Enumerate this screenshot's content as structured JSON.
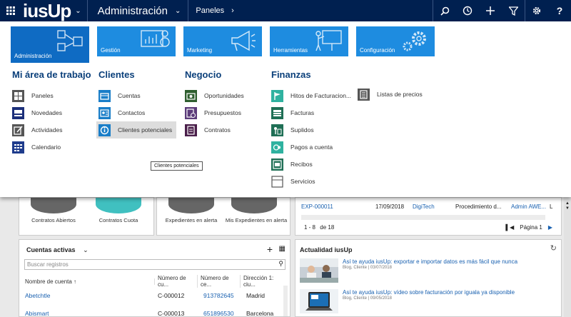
{
  "app": {
    "logo": "iusUp",
    "area": "Administración",
    "breadcrumb": "Paneles"
  },
  "tiles": [
    {
      "label": "Administración",
      "active": true
    },
    {
      "label": "Gestión"
    },
    {
      "label": "Marketing"
    },
    {
      "label": "Herramientas"
    },
    {
      "label": "Configuración"
    }
  ],
  "columns": [
    {
      "title": "Mi área de trabajo",
      "items": [
        "Paneles",
        "Novedades",
        "Actividades",
        "Calendario"
      ]
    },
    {
      "title": "Clientes",
      "items": [
        "Cuentas",
        "Contactos",
        "Clientes potenciales"
      ]
    },
    {
      "title": "Negocio",
      "items": [
        "Oportunidades",
        "Presupuestos",
        "Contratos"
      ]
    },
    {
      "title": "Finanzas",
      "items": [
        "Hitos de Facturacion...",
        "Facturas",
        "Suplidos",
        "Pagos a cuenta",
        "Recibos",
        "Servicios"
      ]
    },
    {
      "title": "",
      "items": [
        "Listas de precios"
      ]
    }
  ],
  "tooltip": "Clientes potenciales",
  "dashboard": {
    "circles": [
      "Contratos Abiertos",
      "Contratos Cuota",
      "Expedientes en alerta",
      "Mis Expedientes en alerta"
    ],
    "exp_row": {
      "id": "EXP-000011",
      "date": "17/09/2018",
      "client": "DigiTech",
      "type": "Procedimiento d...",
      "owner": "Admin AWE...",
      "extra": "L"
    },
    "pager": {
      "range": "1 - 8",
      "of": "de 18",
      "page": "Página 1"
    },
    "accounts": {
      "title": "Cuentas activas",
      "search_placeholder": "Buscar registros",
      "headers": [
        "Nombre de cuenta ↑",
        "Número de cu...",
        "Número de ce...",
        "Dirección 1: ciu..."
      ],
      "rows": [
        [
          "Abetchtle",
          "C-000012",
          "913782645",
          "Madrid"
        ],
        [
          "Abismart",
          "C-000013",
          "651896530",
          "Barcelona"
        ]
      ]
    },
    "news": {
      "title": "Actualidad iusUp",
      "items": [
        {
          "title": "Así te ayuda iusUp: exportar e importar datos es más fácil que nunca",
          "sub": "Blog, Cliente | 03/07/2018"
        },
        {
          "title": "Así te ayuda iusUp: vídeo sobre facturación por iguala ya disponible",
          "sub": "Blog, Cliente | 09/05/2018"
        }
      ]
    }
  },
  "colors": {
    "nav": "#002050",
    "tile": "#1e8ce0",
    "tile_active": "#0f6bc3",
    "heading": "#0a3f7a",
    "circle_gray": "#666666",
    "circle_teal": "#40c0c0"
  }
}
